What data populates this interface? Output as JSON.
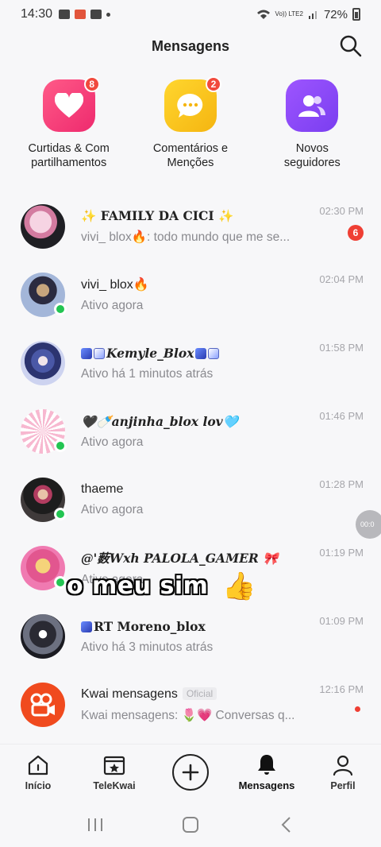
{
  "status_bar": {
    "time": "14:30",
    "battery": "72%",
    "network": "Vo)) LTE2"
  },
  "header": {
    "title": "Mensagens"
  },
  "quick_actions": [
    {
      "label_line1": "Curtidas & Com",
      "label_line2": "partilhamentos",
      "badge": "8",
      "icon": "heart-icon"
    },
    {
      "label_line1": "Comentários e",
      "label_line2": "Menções",
      "badge": "2",
      "icon": "chat-bubble-icon"
    },
    {
      "label_line1": "Novos",
      "label_line2": "seguidores",
      "badge": "",
      "icon": "users-icon"
    }
  ],
  "conversations": [
    {
      "name": "✨ FAMILY DA CICI ✨",
      "sub": "vivi_ blox🔥: todo mundo que me se...",
      "time": "02:30 PM",
      "badge": "6",
      "online": false
    },
    {
      "name": "vivi_ blox🔥",
      "sub": "Ativo agora",
      "time": "02:04 PM",
      "online": true
    },
    {
      "name": "Kemyle_Blox",
      "sub": "Ativo há 1 minutos atrás",
      "time": "01:58 PM",
      "online": false
    },
    {
      "name": "🖤🍼anjinha_blox lov🩵",
      "sub": "Ativo agora",
      "time": "01:46 PM",
      "online": true
    },
    {
      "name": "thaeme",
      "sub": "Ativo agora",
      "time": "01:28 PM",
      "online": true
    },
    {
      "name": "@'薮Wxh PALOLA_GAMER 🎀",
      "sub": "Ativo agora",
      "time": "01:19 PM",
      "online": true
    },
    {
      "name": "RT Moreno_blox",
      "sub": "Ativo há 3 minutos atrás",
      "time": "01:09 PM",
      "online": false
    },
    {
      "name": "Kwai mensagens",
      "official": "Oficial",
      "sub": "Kwai mensagens: 🌷💗 Conversas q...",
      "time": "12:16 PM",
      "online": false,
      "dot": true
    }
  ],
  "caption": {
    "text": "o meu sim",
    "emoji": "👍"
  },
  "float_timer": "00:0",
  "bottom_nav": [
    {
      "label": "Início",
      "icon": "home-icon"
    },
    {
      "label": "TeleKwai",
      "icon": "star-clapper-icon"
    },
    {
      "label": "",
      "icon": "plus-icon"
    },
    {
      "label": "Mensagens",
      "icon": "bell-icon"
    },
    {
      "label": "Perfil",
      "icon": "person-icon"
    }
  ],
  "colors": {
    "accent_red": "#ef3f34",
    "online_green": "#23c552",
    "kwai_orange": "#f04a1e"
  }
}
